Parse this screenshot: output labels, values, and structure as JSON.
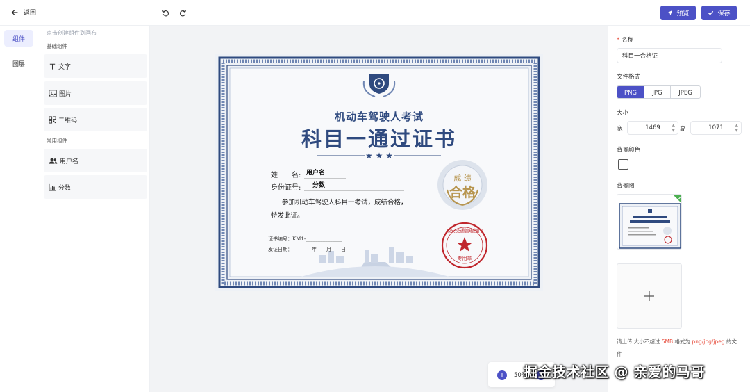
{
  "header": {
    "back_label": "返回",
    "preview_label": "预览",
    "save_label": "保存"
  },
  "leftnav": {
    "items": [
      {
        "label": "组件"
      },
      {
        "label": "图层"
      }
    ]
  },
  "components": {
    "hint": "点击创建组件到画布",
    "basic_title": "基础组件",
    "basic_items": [
      {
        "label": "文字",
        "icon": "text-icon"
      },
      {
        "label": "图片",
        "icon": "image-icon"
      },
      {
        "label": "二维码",
        "icon": "qrcode-icon"
      }
    ],
    "common_title": "常用组件",
    "common_items": [
      {
        "label": "用户名",
        "icon": "users-icon"
      },
      {
        "label": "分数",
        "icon": "bar-chart-icon"
      }
    ]
  },
  "certificate": {
    "subtitle": "机动车驾驶人考试",
    "title": "科目一通过证书",
    "name_label": "姓　　名:",
    "name_value": "用户名",
    "id_label": "身份证号:",
    "id_value": "分数",
    "body_line1": "参加机动车驾驶人科目一考试，成绩合格，",
    "body_line2": "特发此证。",
    "cert_no": "证书编号：KM1-_______________",
    "issue_date": "发证日期：________年____月____日",
    "badge_top": "成 绩",
    "badge_main": "合格",
    "seal_text": "公安交通管理部门",
    "seal_sub": "专用章"
  },
  "zoom": {
    "value": "50%"
  },
  "props": {
    "name_label": "名称",
    "name_value": "科目一合格证",
    "format_label": "文件格式",
    "formats": [
      "PNG",
      "JPG",
      "JPEG"
    ],
    "selected_format": "PNG",
    "size_label": "大小",
    "width_label": "宽",
    "width_value": "1469",
    "height_label": "高",
    "height_value": "1071",
    "bgcolor_label": "背景颜色",
    "bgimage_label": "背景图",
    "upload_hint_prefix": "请上传 大小不超过 ",
    "upload_hint_size": "5MB",
    "upload_hint_mid": " 格式为 ",
    "upload_hint_types": "png/jpg/jpeg",
    "upload_hint_suffix": " 的文件"
  },
  "watermark": "掘金技术社区 @ 亲爱的马哥",
  "colors": {
    "primary": "#4c51c6",
    "cert_blue": "#2f4a7f",
    "seal_red": "#c0272d",
    "badge_gold": "#b7954f"
  }
}
